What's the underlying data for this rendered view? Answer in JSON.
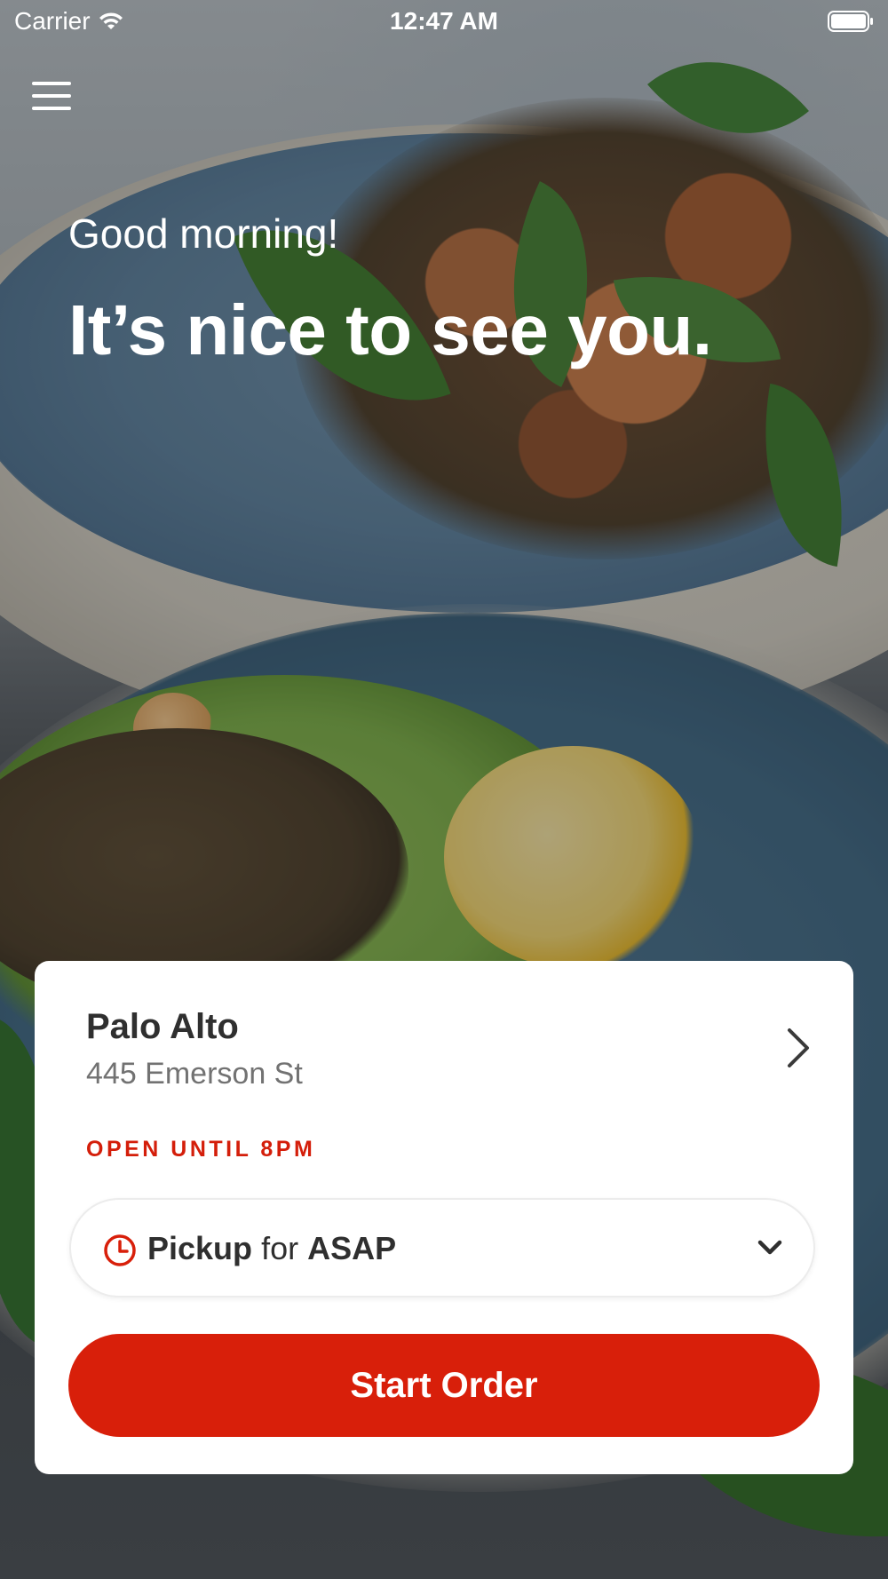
{
  "status_bar": {
    "carrier": "Carrier",
    "time": "12:47 AM",
    "icons": [
      "wifi-icon",
      "battery-icon"
    ]
  },
  "header": {
    "menu_icon": "hamburger-menu-icon",
    "greeting": "Good morning!",
    "headline": "It’s nice to see you."
  },
  "location_card": {
    "name": "Palo Alto",
    "address": "445 Emerson St",
    "open_status": "OPEN UNTIL 8PM",
    "chevron_icon": "chevron-right-icon"
  },
  "order_mode": {
    "icon": "clock-icon",
    "mode": "Pickup",
    "connector": "for",
    "time": "ASAP",
    "dropdown_icon": "chevron-down-icon"
  },
  "start_order_label": "Start Order",
  "colors": {
    "accent": "#d81f0a",
    "open_status": "#d41e0a",
    "card_background": "#ffffff",
    "text_primary": "#2f2f2f",
    "text_secondary": "#727272"
  }
}
